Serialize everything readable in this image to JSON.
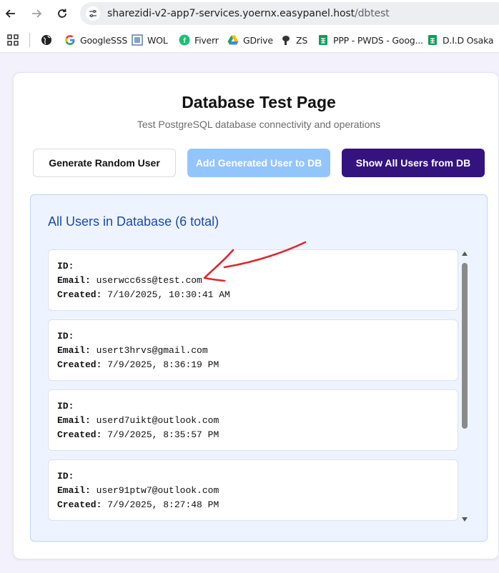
{
  "browser": {
    "url_host": "sharezidi-v2-app7-services.yoernx.easypanel.host",
    "url_path": "/dbtest",
    "bookmarks": [
      {
        "label": "",
        "icon": "globe-icon"
      },
      {
        "label": "GoogleSSS",
        "icon": "google-icon"
      },
      {
        "label": "WOL",
        "icon": "wol-icon"
      },
      {
        "label": "Fiverr",
        "icon": "fiverr-icon"
      },
      {
        "label": "GDrive",
        "icon": "gdrive-icon"
      },
      {
        "label": "ZS",
        "icon": "zs-icon"
      },
      {
        "label": "PPP - PWDS - Goog...",
        "icon": "sheets-icon"
      },
      {
        "label": "D.I.D Osaka",
        "icon": "sheets-icon"
      }
    ]
  },
  "page": {
    "title": "Database Test Page",
    "subtitle": "Test PostgreSQL database connectivity and operations"
  },
  "buttons": {
    "generate": "Generate Random User",
    "add": "Add Generated User to DB",
    "show": "Show All Users from DB"
  },
  "users_panel": {
    "title": "All Users in Database (6 total)",
    "id_label": "ID:",
    "email_label": "Email:",
    "created_label": "Created:",
    "users": [
      {
        "id": "",
        "email": "userwcc6ss@test.com",
        "created": "7/10/2025, 10:30:41 AM"
      },
      {
        "id": "",
        "email": "usert3hrvs@gmail.com",
        "created": "7/9/2025, 8:36:19 PM"
      },
      {
        "id": "",
        "email": "userd7uikt@outlook.com",
        "created": "7/9/2025, 8:35:57 PM"
      },
      {
        "id": "",
        "email": "user91ptw7@outlook.com",
        "created": "7/9/2025, 8:27:48 PM"
      }
    ]
  },
  "colors": {
    "primary_button": "#35137f",
    "disabled_button": "#93c5fd",
    "panel_title": "#1e48a8",
    "annotation": "#e0262b"
  }
}
